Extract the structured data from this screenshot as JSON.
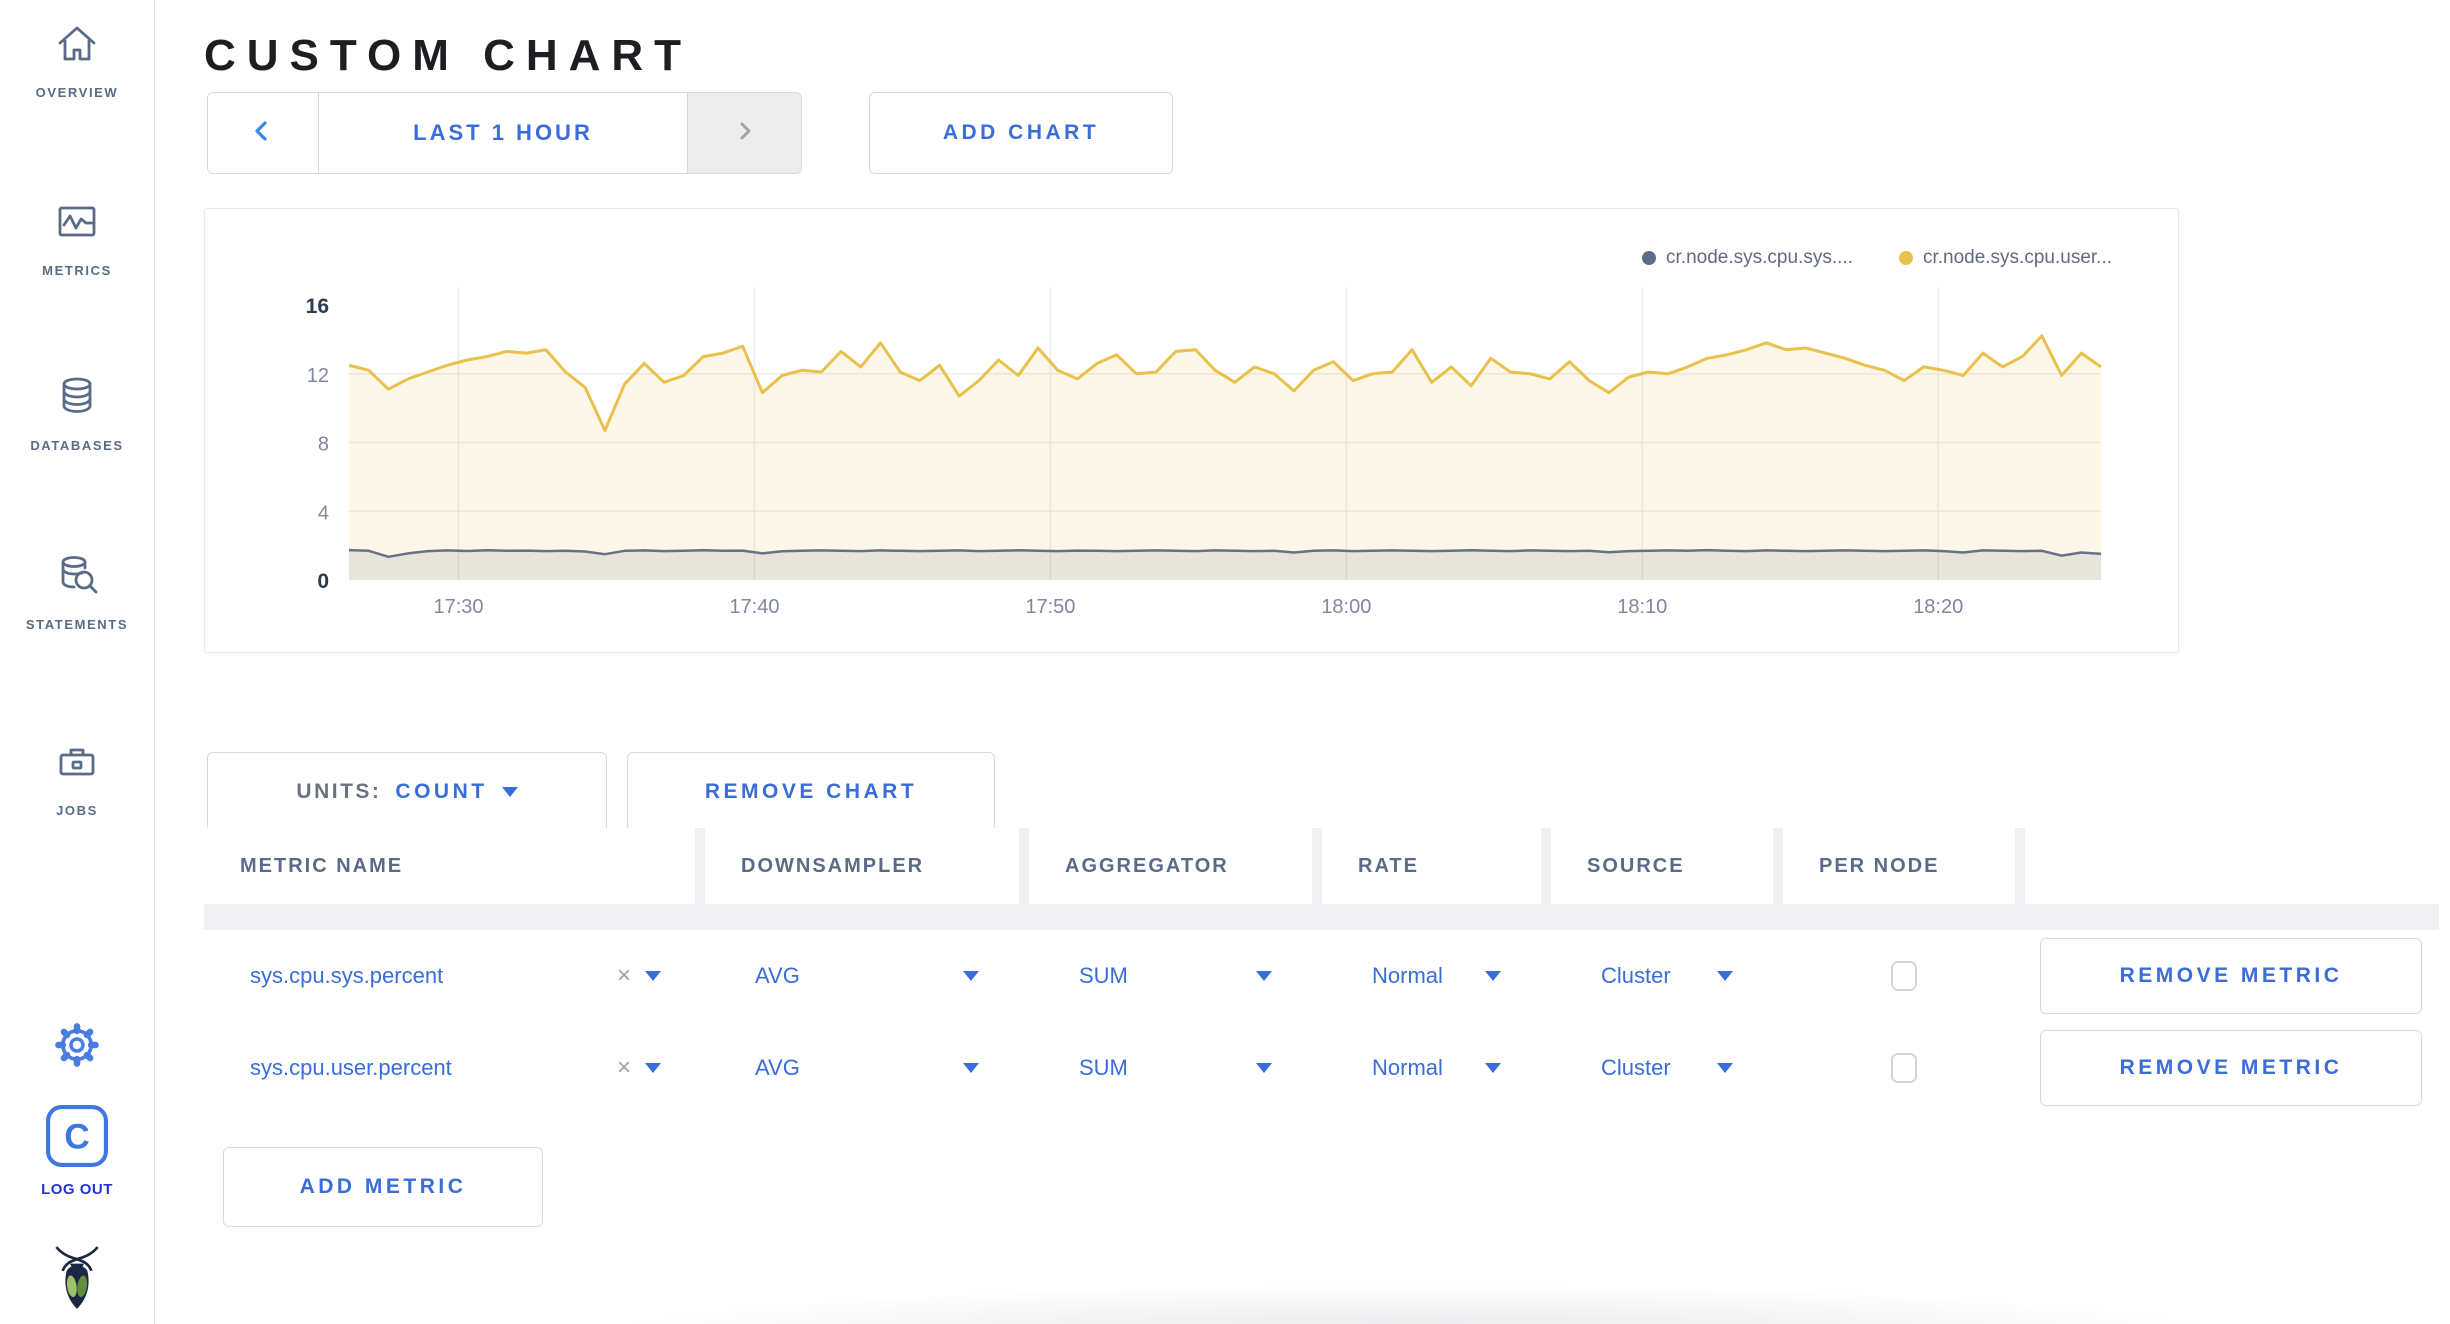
{
  "sidebar": {
    "items": [
      {
        "icon": "home-icon",
        "label": "OVERVIEW"
      },
      {
        "icon": "metrics-graph-icon",
        "label": "METRICS"
      },
      {
        "icon": "database-icon",
        "label": "DATABASES"
      },
      {
        "icon": "statements-search-icon",
        "label": "STATEMENTS"
      },
      {
        "icon": "jobs-briefcase-icon",
        "label": "JOBS"
      }
    ],
    "gear_icon": "gear-icon",
    "logout_icon": "cockroach-c-icon",
    "logout_label": "LOG OUT",
    "brand_icon": "cockroachdb-bug-logo"
  },
  "header": {
    "title": "CUSTOM CHART",
    "time_nav": {
      "prev_icon": "chevron-left",
      "label": "LAST 1 HOUR",
      "next_icon": "chevron-right"
    },
    "add_chart_label": "ADD CHART"
  },
  "chart_data": {
    "type": "line",
    "title": "",
    "x_ticks": [
      "17:30",
      "17:40",
      "17:50",
      "18:00",
      "18:10",
      "18:20"
    ],
    "x_start_min": 1046.3,
    "x_end_min": 1105.5,
    "y_ticks": [
      0,
      4,
      8,
      12,
      16
    ],
    "ylim": [
      0,
      16
    ],
    "grid": true,
    "legend_position": "top-right",
    "legend": [
      {
        "name": "cr.node.sys.cpu.sys....",
        "color": "#5f6c87"
      },
      {
        "name": "cr.node.sys.cpu.user...",
        "color": "#e9c14b"
      }
    ],
    "series": [
      {
        "name": "cr.node.sys.cpu.user",
        "color": "#e9c14b",
        "fill": "rgba(234,195,80,0.13)",
        "width": 3,
        "values": [
          12.5,
          12.2,
          11.1,
          11.7,
          12.1,
          12.5,
          12.8,
          13.0,
          13.3,
          13.2,
          13.4,
          12.1,
          11.2,
          8.7,
          11.4,
          12.6,
          11.5,
          11.9,
          13.0,
          13.2,
          13.6,
          10.9,
          11.9,
          12.2,
          12.1,
          13.3,
          12.4,
          13.8,
          12.1,
          11.6,
          12.5,
          10.7,
          11.6,
          12.8,
          11.9,
          13.5,
          12.2,
          11.7,
          12.6,
          13.1,
          12.0,
          12.1,
          13.3,
          13.4,
          12.2,
          11.5,
          12.4,
          12.0,
          11.0,
          12.2,
          12.7,
          11.6,
          12.0,
          12.1,
          13.4,
          11.5,
          12.4,
          11.3,
          12.9,
          12.1,
          12.0,
          11.7,
          12.7,
          11.6,
          10.9,
          11.8,
          12.1,
          12.0,
          12.4,
          12.9,
          13.1,
          13.4,
          13.8,
          13.4,
          13.5,
          13.2,
          12.9,
          12.5,
          12.2,
          11.6,
          12.4,
          12.2,
          11.9,
          13.2,
          12.4,
          13.0,
          14.2,
          11.9,
          13.2,
          12.4
        ]
      },
      {
        "name": "cr.node.sys.cpu.sys",
        "color": "#67718a",
        "fill": "rgba(90,100,125,0.13)",
        "width": 2.5,
        "values": [
          1.74,
          1.7,
          1.35,
          1.55,
          1.68,
          1.72,
          1.69,
          1.73,
          1.7,
          1.71,
          1.68,
          1.7,
          1.66,
          1.5,
          1.7,
          1.72,
          1.68,
          1.7,
          1.73,
          1.7,
          1.71,
          1.55,
          1.67,
          1.7,
          1.72,
          1.7,
          1.68,
          1.72,
          1.7,
          1.68,
          1.7,
          1.72,
          1.68,
          1.7,
          1.73,
          1.7,
          1.68,
          1.71,
          1.7,
          1.68,
          1.7,
          1.72,
          1.7,
          1.68,
          1.72,
          1.7,
          1.68,
          1.7,
          1.6,
          1.7,
          1.72,
          1.68,
          1.7,
          1.72,
          1.7,
          1.68,
          1.7,
          1.73,
          1.7,
          1.68,
          1.72,
          1.7,
          1.68,
          1.7,
          1.62,
          1.68,
          1.7,
          1.72,
          1.7,
          1.74,
          1.7,
          1.68,
          1.72,
          1.7,
          1.68,
          1.7,
          1.72,
          1.7,
          1.68,
          1.7,
          1.72,
          1.68,
          1.6,
          1.72,
          1.7,
          1.68,
          1.7,
          1.42,
          1.6,
          1.52
        ]
      }
    ]
  },
  "chart_controls": {
    "units_label": "UNITS:",
    "units_value": "COUNT",
    "remove_chart_label": "REMOVE CHART"
  },
  "table": {
    "columns": [
      "METRIC NAME",
      "DOWNSAMPLER",
      "AGGREGATOR",
      "RATE",
      "SOURCE",
      "PER NODE",
      ""
    ],
    "clear_glyph": "×",
    "rows": [
      {
        "metric_name": "sys.cpu.sys.percent",
        "downsampler": "AVG",
        "aggregator": "SUM",
        "rate": "Normal",
        "source": "Cluster",
        "per_node_checked": false
      },
      {
        "metric_name": "sys.cpu.user.percent",
        "downsampler": "AVG",
        "aggregator": "SUM",
        "rate": "Normal",
        "source": "Cluster",
        "per_node_checked": false
      }
    ],
    "remove_metric_label": "REMOVE METRIC",
    "add_metric_label": "ADD METRIC"
  },
  "colors": {
    "accent_blue": "#3a6dd9",
    "logout_blue": "#2533dd",
    "sidebar_slate": "#5a6b87",
    "series_yellow": "#e9c14b",
    "series_dark": "#67718a",
    "grid_grey": "#ececec"
  }
}
